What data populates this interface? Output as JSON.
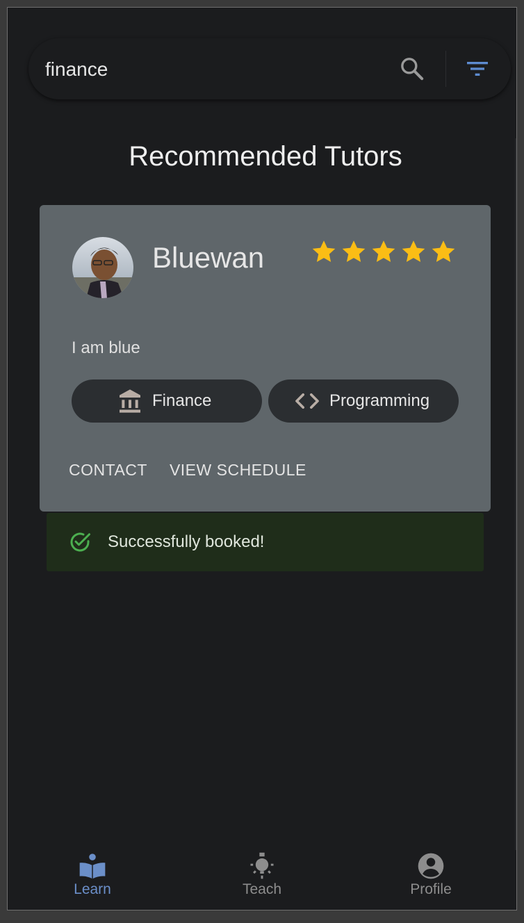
{
  "search": {
    "value": "finance"
  },
  "page": {
    "title": "Recommended Tutors"
  },
  "tutor": {
    "name": "Bluewan",
    "rating": 5,
    "rating_max": 5,
    "bio": "I am blue",
    "subjects": [
      {
        "label": "Finance",
        "icon": "bank-icon"
      },
      {
        "label": "Programming",
        "icon": "code-icon"
      }
    ],
    "actions": {
      "contact": "CONTACT",
      "schedule": "VIEW SCHEDULE"
    }
  },
  "toast": {
    "message": "Successfully booked!",
    "icon": "check-circle-icon"
  },
  "nav": {
    "items": [
      {
        "label": "Learn",
        "icon": "book-reader-icon",
        "active": true
      },
      {
        "label": "Teach",
        "icon": "lightbulb-icon",
        "active": false
      },
      {
        "label": "Profile",
        "icon": "account-circle-icon",
        "active": false
      }
    ]
  },
  "colors": {
    "background": "#1b1c1e",
    "card": "#5f666a",
    "chip": "#2b2e31",
    "star": "#fbbd15",
    "accent": "#6b8fc9",
    "success": "#4caf50",
    "toast_bg": "#1f2d1a"
  }
}
